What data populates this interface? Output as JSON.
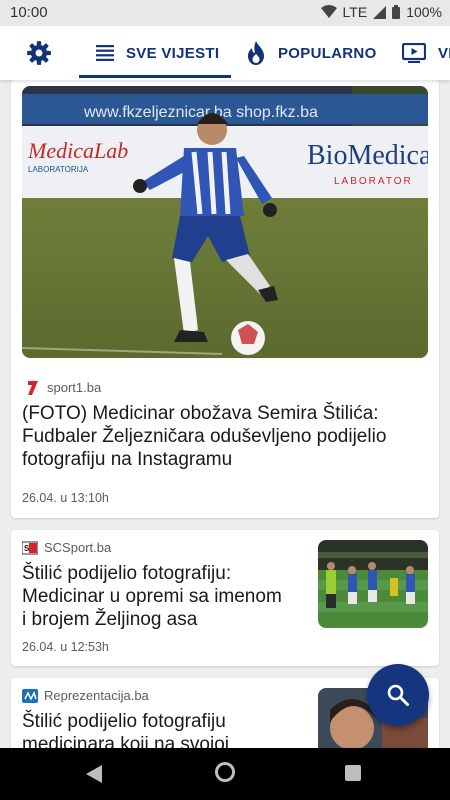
{
  "status_bar": {
    "time": "10:00",
    "network": "LTE",
    "battery": "100%"
  },
  "tabs": [
    {
      "label": "SVE VIJESTI",
      "icon": "list-icon",
      "selected": true
    },
    {
      "label": "POPULARNO",
      "icon": "flame-icon",
      "selected": false
    },
    {
      "label": "VI",
      "icon": "video-icon",
      "selected": false
    }
  ],
  "articles": [
    {
      "source": "sport1.ba",
      "headline_lines": [
        "(FOTO) Medicinar obožava Semira Štilića:",
        "Fudbaler Željezničara oduševljeno podijelio",
        "fotografiju na Instagramu"
      ],
      "date": "26.04. u 13:10h",
      "image_text": {
        "banner": "www.fkzeljeznicar.ba  shop.fkz.ba",
        "board_left": "MedicaLab",
        "board_left_sub": "LABORATORIJA",
        "board_right": "BioMedica",
        "board_right_sub": "LABORATOR"
      }
    },
    {
      "source": "SCSport.ba",
      "headline_lines": [
        "Štilić podijelio fotografiju:",
        "Medicinar u opremi sa imenom",
        "i brojem Željinog asa"
      ],
      "date": "26.04. u 12:53h"
    },
    {
      "source": "Reprezentacija.ba",
      "headline_lines": [
        "Štilić podijelio fotografiju",
        "medicinara koji na svojoj"
      ]
    }
  ],
  "colors": {
    "primary": "#12327a",
    "fab": "#15357f",
    "sport1_logo": "#d8232a"
  }
}
